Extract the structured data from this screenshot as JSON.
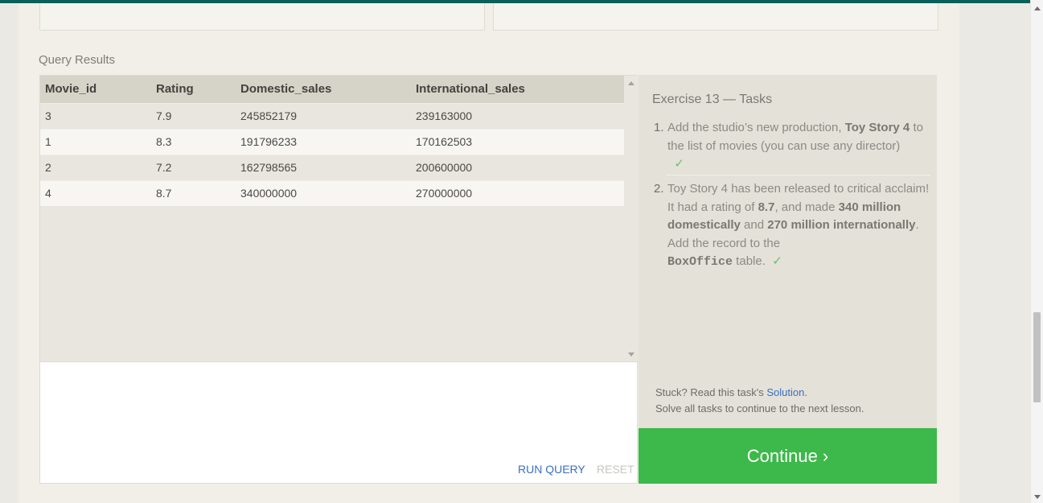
{
  "results": {
    "label": "Query Results",
    "columns": [
      "Movie_id",
      "Rating",
      "Domestic_sales",
      "International_sales"
    ],
    "rows": [
      [
        "3",
        "7.9",
        "245852179",
        "239163000"
      ],
      [
        "1",
        "8.3",
        "191796233",
        "170162503"
      ],
      [
        "2",
        "7.2",
        "162798565",
        "200600000"
      ],
      [
        "4",
        "8.7",
        "340000000",
        "270000000"
      ]
    ]
  },
  "actions": {
    "run": "RUN QUERY",
    "reset": "RESET"
  },
  "tasks": {
    "title": "Exercise 13 — Tasks",
    "items": [
      {
        "num": "1.",
        "t1": "Add the studio’s new production, ",
        "b1": "Toy Story 4",
        "t2": " to the list of movies (you can use any director)",
        "check": "✓"
      },
      {
        "num": "2.",
        "t1": "Toy Story 4 has been released to critical acclaim! It had a rating of ",
        "b1": "8.7",
        "t2": ", and made ",
        "b2": "340 million domestically",
        "t3": " and ",
        "b3": "270 million internationally",
        "t4": ". Add the record to the ",
        "code": "BoxOffice",
        "t5": " table.",
        "check": "✓"
      }
    ],
    "stuck_text": "Stuck? Read this task's ",
    "solution_link": "Solution",
    "stuck_end": ".",
    "solve_all": "Solve all tasks to continue to the next lesson."
  },
  "continue_label": "Continue ›",
  "colors": {
    "accent_green": "#3db84a",
    "link_blue": "#3b6ec2",
    "topbar": "#0b5f5a"
  }
}
